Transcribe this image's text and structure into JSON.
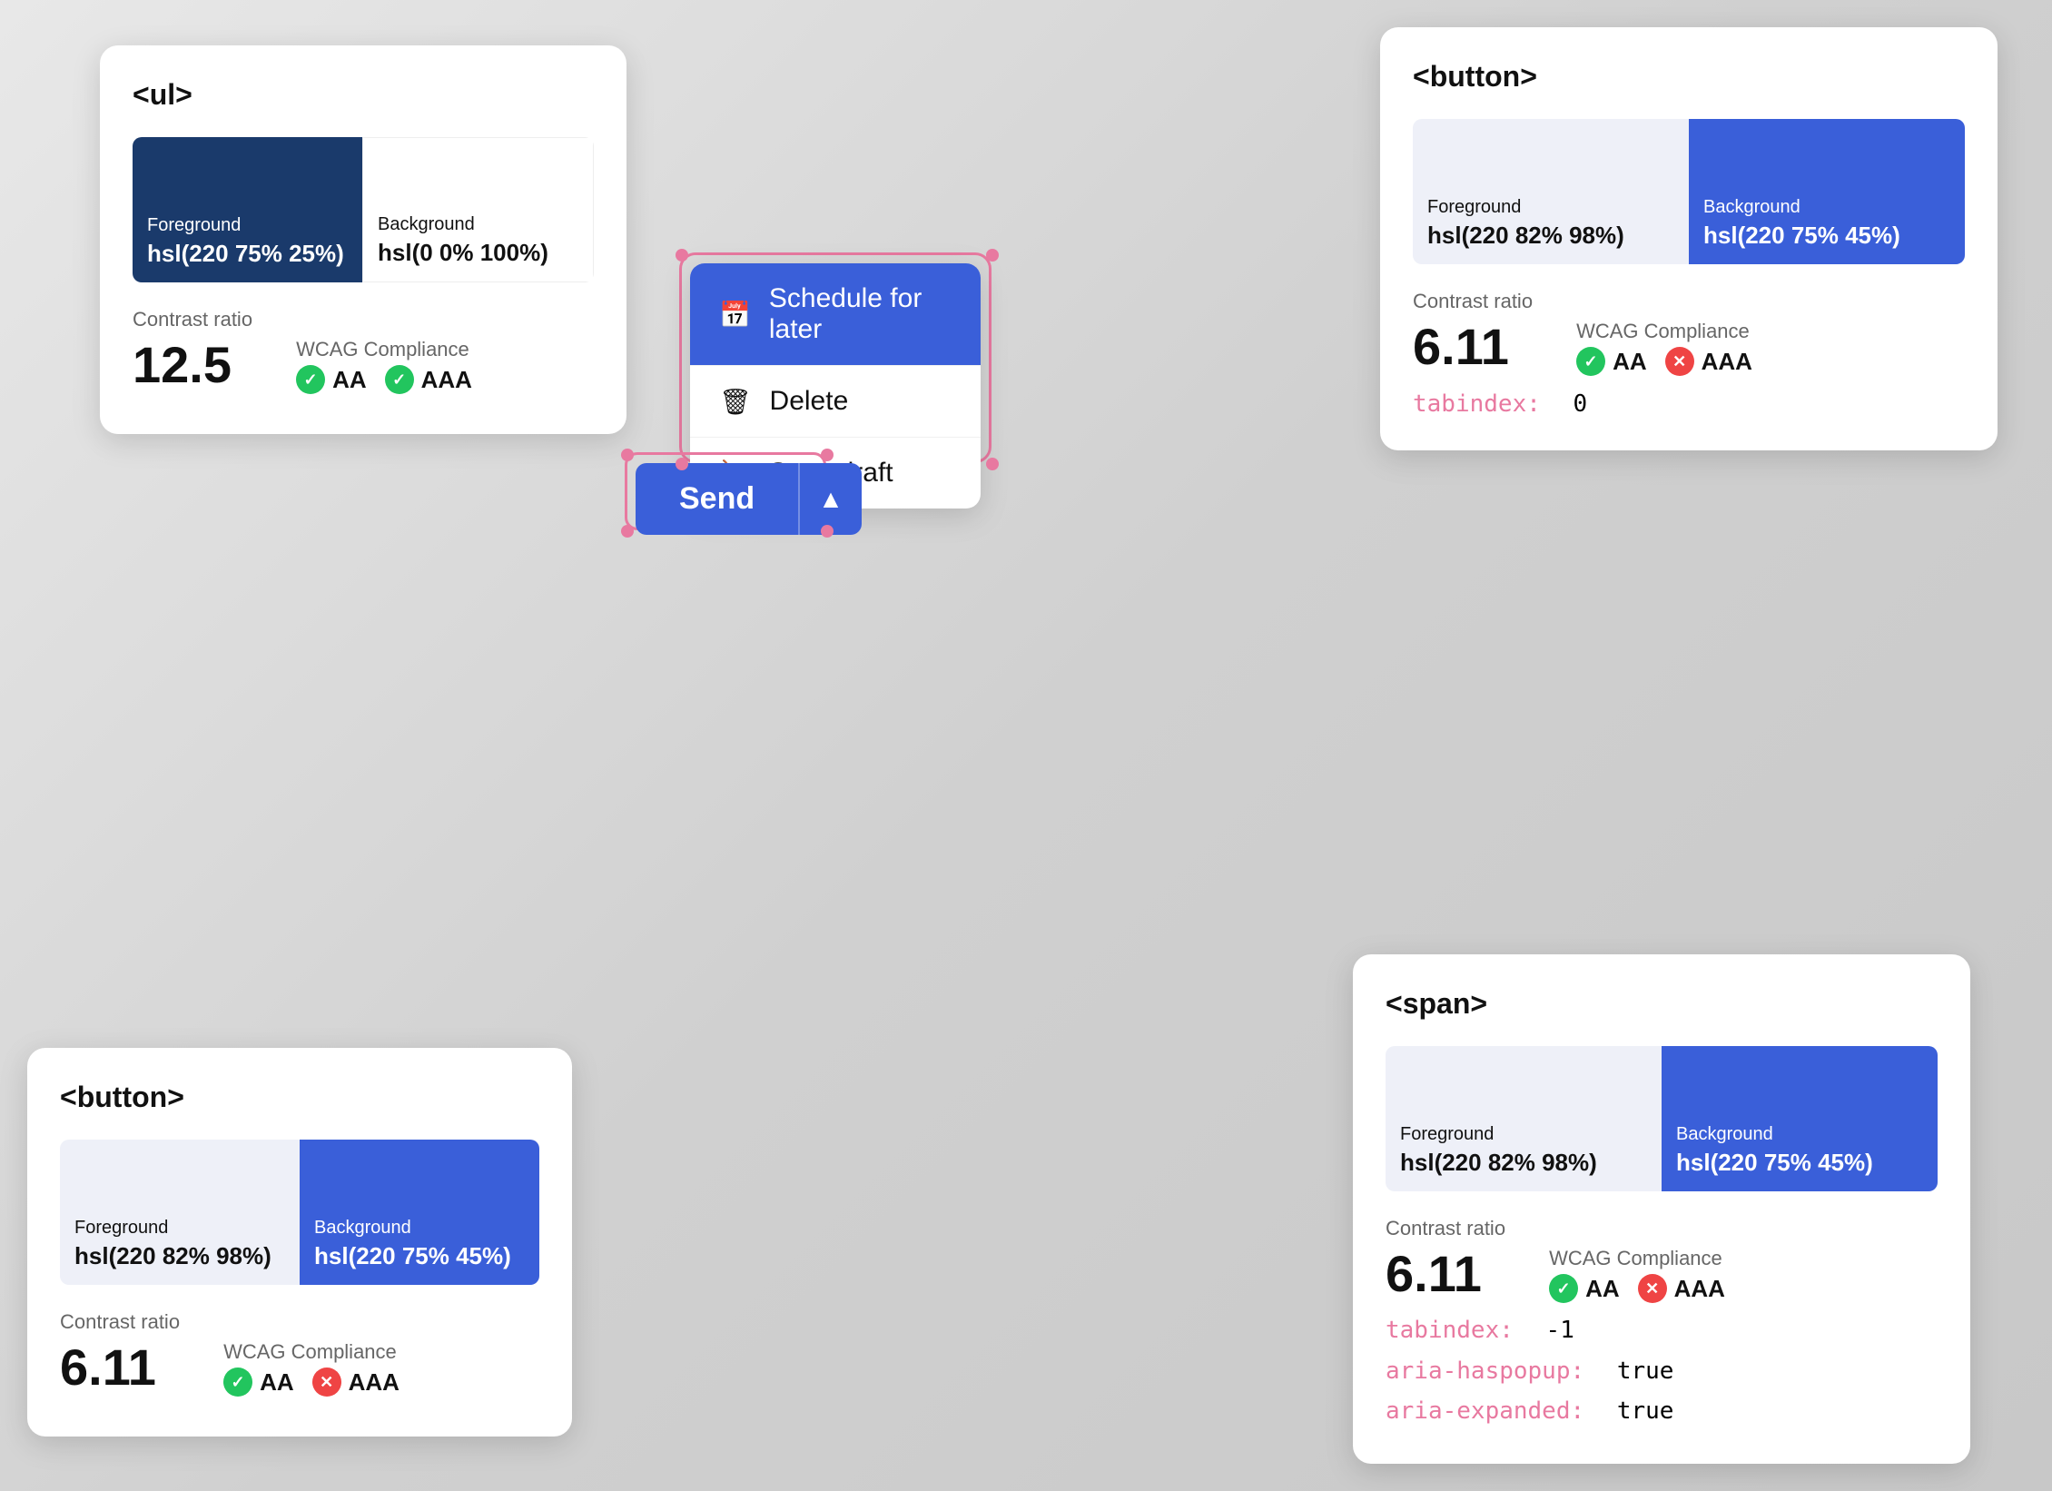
{
  "cards": {
    "ul": {
      "tag": "<ul>",
      "foreground": {
        "label": "Foreground",
        "value": "hsl(220 75% 25%)"
      },
      "background": {
        "label": "Background",
        "value": "hsl(0 0% 100%)"
      },
      "contrast_ratio_label": "Contrast ratio",
      "contrast_ratio_value": "12.5",
      "wcag_label": "WCAG Compliance",
      "aa_label": "AA",
      "aaa_label": "AAA"
    },
    "button_top": {
      "tag": "<button>",
      "foreground": {
        "label": "Foreground",
        "value": "hsl(220 82% 98%)"
      },
      "background": {
        "label": "Background",
        "value": "hsl(220 75% 45%)"
      },
      "contrast_ratio_label": "Contrast ratio",
      "contrast_ratio_value": "6.11",
      "wcag_label": "WCAG Compliance",
      "aa_label": "AA",
      "aaa_label": "AAA",
      "tabindex_label": "tabindex:",
      "tabindex_value": "0"
    },
    "button_bottom": {
      "tag": "<button>",
      "foreground": {
        "label": "Foreground",
        "value": "hsl(220 82% 98%)"
      },
      "background": {
        "label": "Background",
        "value": "hsl(220 75% 45%)"
      },
      "contrast_ratio_label": "Contrast ratio",
      "contrast_ratio_value": "6.11",
      "wcag_label": "WCAG Compliance",
      "aa_label": "AA",
      "aaa_label": "AAA"
    },
    "span": {
      "tag": "<span>",
      "foreground": {
        "label": "Foreground",
        "value": "hsl(220 82% 98%)"
      },
      "background": {
        "label": "Background",
        "value": "hsl(220 75% 45%)"
      },
      "contrast_ratio_label": "Contrast ratio",
      "contrast_ratio_value": "6.11",
      "wcag_label": "WCAG Compliance",
      "aa_label": "AA",
      "aaa_label": "AAA",
      "tabindex_label": "tabindex:",
      "tabindex_value": "-1",
      "aria_haspopup_label": "aria-haspopup:",
      "aria_haspopup_value": "true",
      "aria_expanded_label": "aria-expanded:",
      "aria_expanded_value": "true"
    }
  },
  "dropdown": {
    "items": [
      {
        "label": "Schedule for later",
        "icon": "📅",
        "active": true
      },
      {
        "label": "Delete",
        "icon": "🗑",
        "active": false
      },
      {
        "label": "Save draft",
        "icon": "🔖",
        "active": false
      }
    ]
  },
  "send_button": {
    "label": "Send",
    "caret": "▲"
  }
}
